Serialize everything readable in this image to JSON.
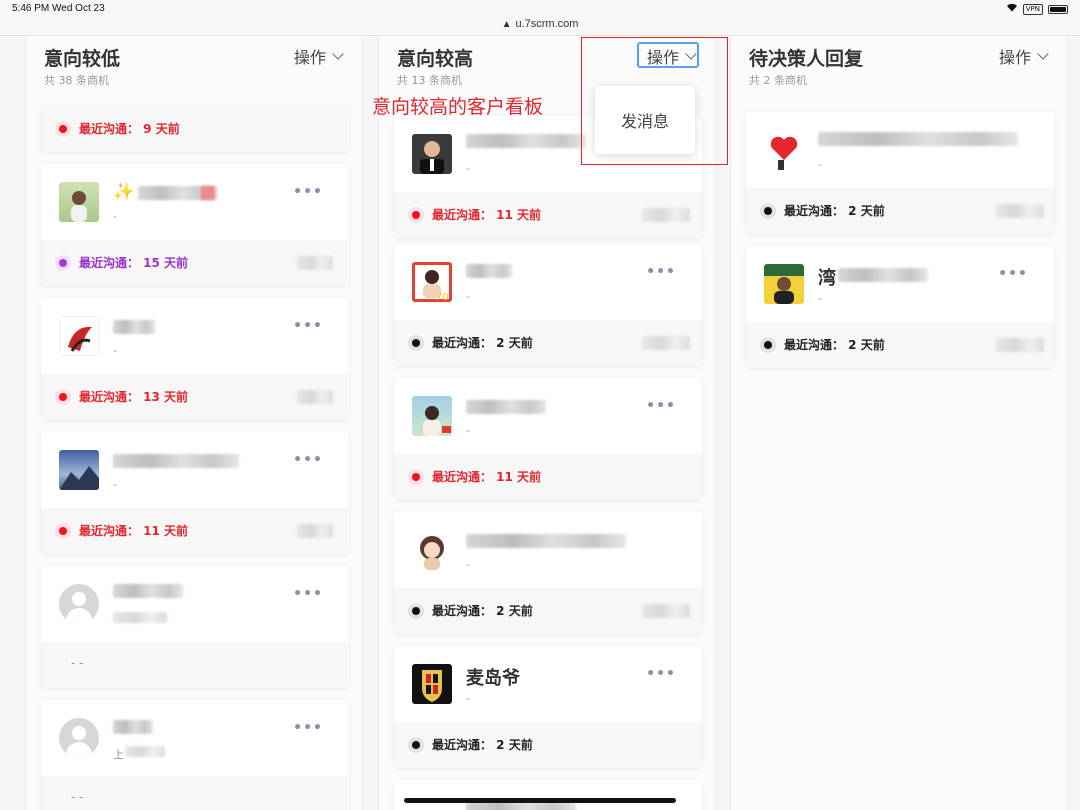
{
  "status_bar": {
    "time_date": "5:46 PM   Wed Oct 23",
    "url": "u.7scrm.com",
    "vpn": "VPN"
  },
  "columns": [
    {
      "title": "意向较低",
      "count": "共 38 条商机",
      "action": "操作",
      "cards": [
        {
          "recent": "最近沟通：  9 天前",
          "status": "red"
        },
        {
          "name": "✨",
          "sub": "-",
          "recent": "最近沟通：  15 天前",
          "status": "purple"
        },
        {
          "name": "",
          "sub": "-",
          "recent": "最近沟通：  13 天前",
          "status": "red"
        },
        {
          "name": "",
          "sub": "-",
          "recent": "最近沟通：  11 天前",
          "status": "red"
        },
        {
          "name": "",
          "sub": "",
          "recent": "- -",
          "status": "none"
        },
        {
          "name": "",
          "sub": "上",
          "recent": "- -",
          "status": "none"
        }
      ]
    },
    {
      "title": "意向较高",
      "count": "共 13 条商机",
      "action": "操作",
      "cards": [
        {
          "name": "",
          "sub": "-",
          "recent": "最近沟通：  11 天前",
          "status": "red"
        },
        {
          "name": "",
          "sub": "-",
          "recent": "最近沟通：  2 天前",
          "status": "black"
        },
        {
          "name": "",
          "sub": "-",
          "recent": "最近沟通：  11 天前",
          "status": "red"
        },
        {
          "name": "",
          "sub": "-",
          "recent": "最近沟通：  2 天前",
          "status": "black"
        },
        {
          "name": "麦岛爷",
          "sub": "-",
          "recent": "最近沟通：  2 天前",
          "status": "black"
        }
      ]
    },
    {
      "title": "待决策人回复",
      "count": "共 2 条商机",
      "action": "操作",
      "cards": [
        {
          "name": "",
          "sub": "-",
          "recent": "最近沟通：  2 天前",
          "status": "black"
        },
        {
          "name": "湾",
          "sub": "-",
          "recent": "最近沟通：  2 天前",
          "status": "black"
        }
      ]
    }
  ],
  "dropdown": {
    "item": "发消息"
  },
  "annotation": "意向较高的客户看板",
  "more_label": "•••",
  "colors": {
    "red": "#e5262d",
    "purple": "#9b33c9",
    "focus_blue": "#5d9ef0"
  }
}
